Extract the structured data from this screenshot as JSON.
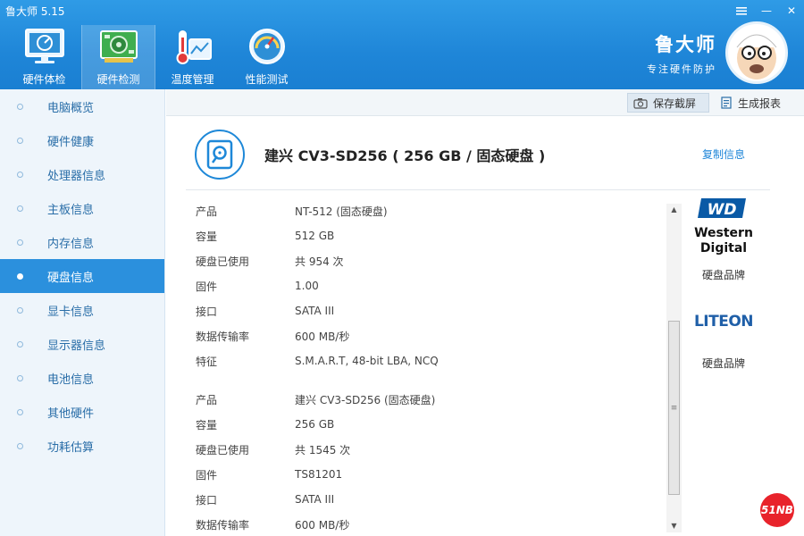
{
  "app": {
    "title": "鲁大师 5.15"
  },
  "window_controls": {
    "menu_icon": "menu-icon",
    "minimize": "—",
    "close": "✕"
  },
  "tabs": [
    {
      "label": "硬件体检",
      "icon": "monitor-check-icon"
    },
    {
      "label": "硬件检测",
      "icon": "circuit-board-icon",
      "active": true
    },
    {
      "label": "温度管理",
      "icon": "thermometer-icon"
    },
    {
      "label": "性能测试",
      "icon": "speedometer-icon"
    }
  ],
  "brand": {
    "name": "鲁大师",
    "slogan": "专注硬件防护"
  },
  "sidebar": {
    "items": [
      {
        "label": "电脑概览"
      },
      {
        "label": "硬件健康"
      },
      {
        "label": "处理器信息"
      },
      {
        "label": "主板信息"
      },
      {
        "label": "内存信息"
      },
      {
        "label": "硬盘信息",
        "active": true
      },
      {
        "label": "显卡信息"
      },
      {
        "label": "显示器信息"
      },
      {
        "label": "电池信息"
      },
      {
        "label": "其他硬件"
      },
      {
        "label": "功耗估算"
      }
    ]
  },
  "toolbar": {
    "screenshot_label": "保存截屏",
    "report_label": "生成报表"
  },
  "main": {
    "title": "建兴 CV3-SD256 ( 256 GB / 固态硬盘 )",
    "copy_label": "复制信息",
    "disks": [
      {
        "rows": [
          {
            "key": "产品",
            "value": "NT-512 (固态硬盘)"
          },
          {
            "key": "容量",
            "value": "512 GB"
          },
          {
            "key": "硬盘已使用",
            "value": "共 954 次"
          },
          {
            "key": "固件",
            "value": "1.00"
          },
          {
            "key": "接口",
            "value": "SATA III"
          },
          {
            "key": "数据传输率",
            "value": "600 MB/秒"
          },
          {
            "key": "特征",
            "value": "S.M.A.R.T,  48-bit LBA,  NCQ"
          }
        ]
      },
      {
        "rows": [
          {
            "key": "产品",
            "value": "建兴  CV3-SD256 (固态硬盘)"
          },
          {
            "key": "容量",
            "value": "256 GB"
          },
          {
            "key": "硬盘已使用",
            "value": "共 1545 次"
          },
          {
            "key": "固件",
            "value": "TS81201"
          },
          {
            "key": "接口",
            "value": "SATA III"
          },
          {
            "key": "数据传输率",
            "value": "600 MB/秒"
          }
        ]
      }
    ]
  },
  "brands": [
    {
      "logo_line1": "WD",
      "logo_line2": "Western",
      "logo_line3": "Digital",
      "caption": "硬盘品牌"
    },
    {
      "logo_text": "LITEON",
      "caption": "硬盘品牌"
    }
  ],
  "watermark": {
    "text": "51NB"
  },
  "colors": {
    "header": "#1f86d8",
    "sidebar_active": "#2b90dd",
    "accent": "#1e88d8"
  }
}
